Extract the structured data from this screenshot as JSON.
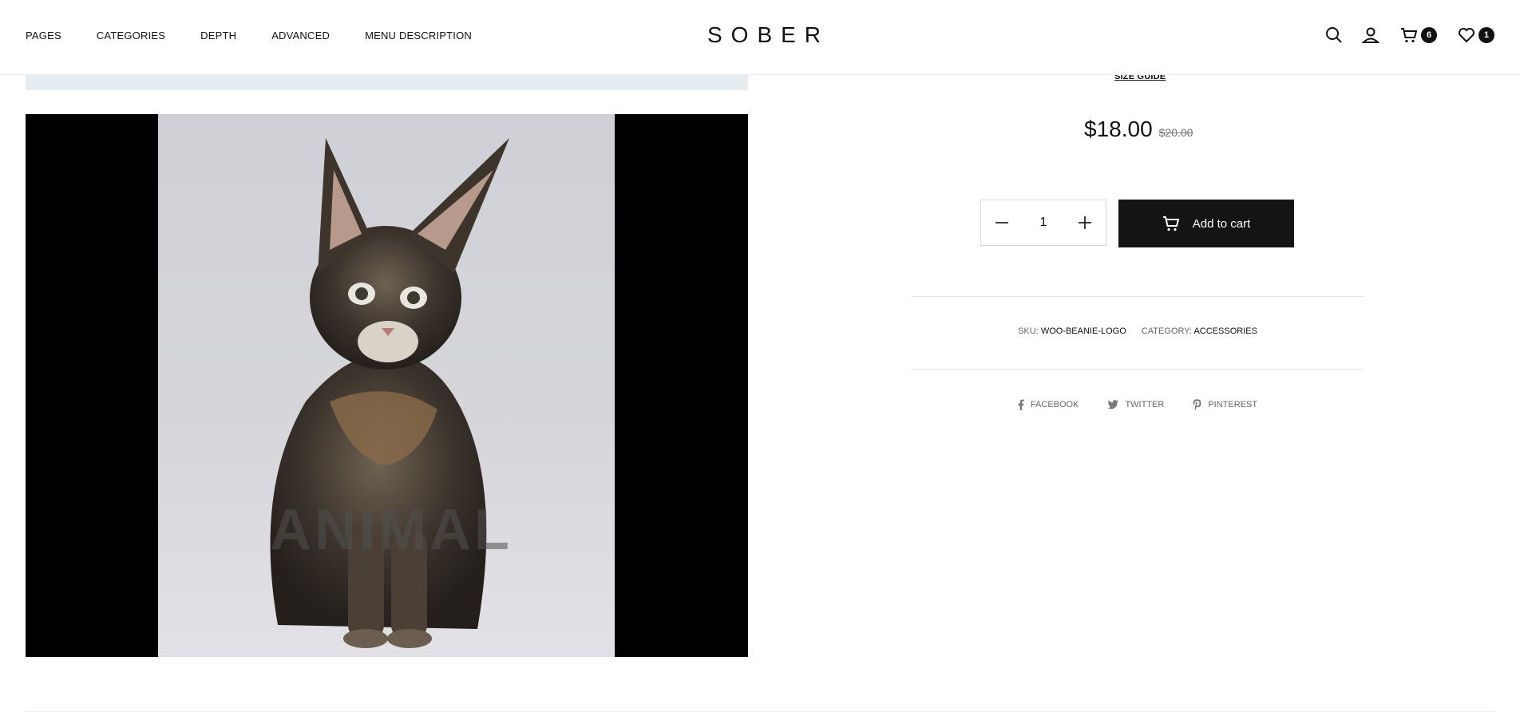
{
  "nav": {
    "items": [
      "PAGES",
      "CATEGORIES",
      "DEPTH",
      "ADVANCED",
      "MENU DESCRIPTION"
    ]
  },
  "logo": "SOBER",
  "header_icons": {
    "search": "search-icon",
    "account": "user-icon",
    "cart": "cart-icon",
    "cart_count": "6",
    "wishlist": "heart-icon",
    "wishlist_count": "1"
  },
  "gallery": {
    "video_watermark": "ANIMAL"
  },
  "product": {
    "size_guide": "SIZE GUIDE",
    "price_current": "$18.00",
    "price_old": "$20.00",
    "quantity": "1",
    "add_to_cart": "Add to cart",
    "sku_label": "SKU:",
    "sku_value": "WOO-BEANIE-LOGO",
    "category_label": "CATEGORY:",
    "category_value": "ACCESSORIES"
  },
  "share": {
    "facebook": "FACEBOOK",
    "twitter": "TWITTER",
    "pinterest": "PINTEREST"
  },
  "colors": {
    "accent": "#141414",
    "badge": "#111111",
    "strip": "#e6edf1"
  }
}
